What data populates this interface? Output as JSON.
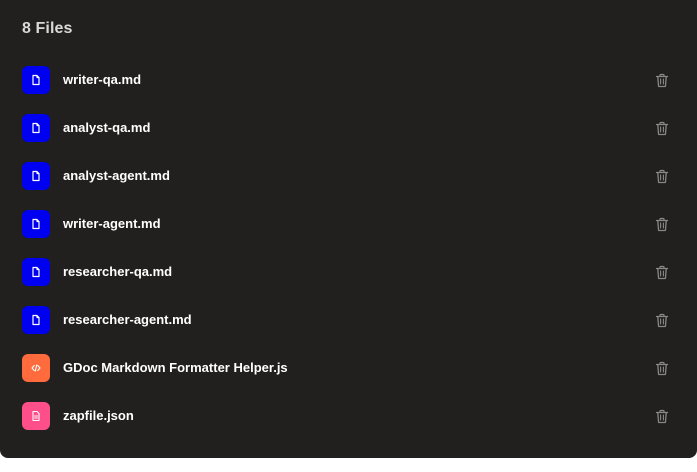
{
  "header": {
    "title": "8 Files"
  },
  "colors": {
    "background": "#21201e",
    "markdown_icon": "#0000f0",
    "script_icon": "#ff6b3d",
    "json_icon": "#ff4f8b",
    "trash_icon": "#8a8884"
  },
  "files": [
    {
      "name": "writer-qa.md",
      "type": "markdown",
      "icon": "document-icon"
    },
    {
      "name": "analyst-qa.md",
      "type": "markdown",
      "icon": "document-icon"
    },
    {
      "name": "analyst-agent.md",
      "type": "markdown",
      "icon": "document-icon"
    },
    {
      "name": "writer-agent.md",
      "type": "markdown",
      "icon": "document-icon"
    },
    {
      "name": "researcher-qa.md",
      "type": "markdown",
      "icon": "document-icon"
    },
    {
      "name": "researcher-agent.md",
      "type": "markdown",
      "icon": "document-icon"
    },
    {
      "name": "GDoc Markdown Formatter Helper.js",
      "type": "script",
      "icon": "code-icon"
    },
    {
      "name": "zapfile.json",
      "type": "json",
      "icon": "data-file-icon"
    }
  ]
}
